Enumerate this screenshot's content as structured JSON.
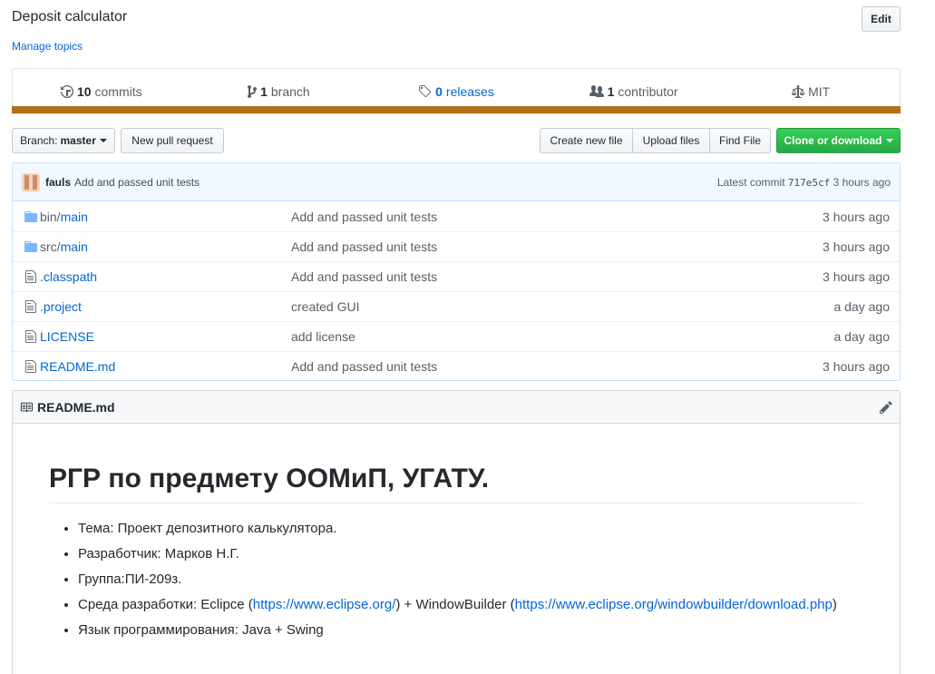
{
  "repo": {
    "description": "Deposit calculator",
    "manage_topics": "Manage topics",
    "edit_label": "Edit"
  },
  "summary": {
    "commits_count": "10",
    "commits_label": "commits",
    "branch_count": "1",
    "branch_label": "branch",
    "releases_count": "0",
    "releases_label": "releases",
    "contributor_count": "1",
    "contributor_label": "contributor",
    "license": "MIT",
    "language_color": "#b07219"
  },
  "toolbar": {
    "branch_prefix": "Branch:",
    "branch_name": "master",
    "new_pull_request": "New pull request",
    "create_new_file": "Create new file",
    "upload_files": "Upload files",
    "find_file": "Find File",
    "clone_or_download": "Clone or download"
  },
  "latest_commit": {
    "author": "fauls",
    "message": "Add and passed unit tests",
    "label": "Latest commit",
    "sha": "717e5cf",
    "age": "3 hours ago"
  },
  "files": [
    {
      "type": "folder",
      "prefix": "bin/",
      "name": "main",
      "message": "Add and passed unit tests",
      "age": "3 hours ago"
    },
    {
      "type": "folder",
      "prefix": "src/",
      "name": "main",
      "message": "Add and passed unit tests",
      "age": "3 hours ago"
    },
    {
      "type": "file",
      "prefix": "",
      "name": ".classpath",
      "message": "Add and passed unit tests",
      "age": "3 hours ago"
    },
    {
      "type": "file",
      "prefix": "",
      "name": ".project",
      "message": "created GUI",
      "age": "a day ago"
    },
    {
      "type": "file",
      "prefix": "",
      "name": "LICENSE",
      "message": "add license",
      "age": "a day ago"
    },
    {
      "type": "file",
      "prefix": "",
      "name": "README.md",
      "message": "Add and passed unit tests",
      "age": "3 hours ago"
    }
  ],
  "readme": {
    "filename": "README.md",
    "heading": "РГР по предмету ООМиП, УГАТУ.",
    "items": {
      "topic": "Тема: Проект депозитного калькулятора.",
      "developer": "Разработчик: Марков Н.Г.",
      "group": "Группа:ПИ-209з.",
      "env_prefix": "Среда разработки: Eclipce (",
      "env_link1": "https://www.eclipse.org/",
      "env_middle": ") + WindowBuilder (",
      "env_link2": "https://www.eclipse.org/windowbuilder/download.php",
      "env_suffix": ")",
      "language": "Язык программирования: Java + Swing"
    }
  }
}
